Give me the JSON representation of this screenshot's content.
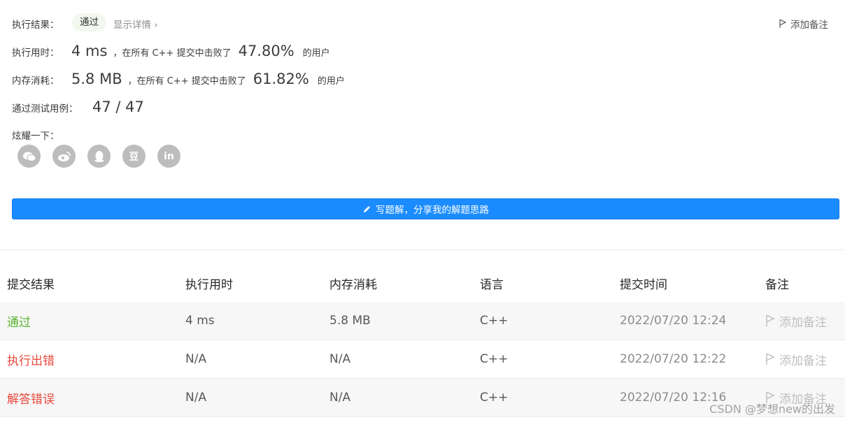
{
  "result": {
    "label": "执行结果：",
    "status": "通过",
    "details_link": "显示详情 ›",
    "add_note": "添加备注"
  },
  "time_stat": {
    "label": "执行用时：",
    "value": "4 ms",
    "mid_text": "，在所有 C++ 提交中击败了",
    "percent": "47.80%",
    "tail": "的用户"
  },
  "memory_stat": {
    "label": "内存消耗：",
    "value": "5.8 MB",
    "mid_text": "，在所有 C++ 提交中击败了",
    "percent": "61.82%",
    "tail": "的用户"
  },
  "test_cases": {
    "label": "通过测试用例：",
    "value": "47 / 47"
  },
  "share": {
    "label": "炫耀一下：",
    "icons": [
      "wechat-icon",
      "weibo-icon",
      "qq-icon",
      "douban-icon",
      "linkedin-icon"
    ],
    "douban_glyph": "豆",
    "linkedin_glyph": "in"
  },
  "solution_button": "写题解，分享我的解题思路",
  "table": {
    "headers": [
      "提交结果",
      "执行用时",
      "内存消耗",
      "语言",
      "提交时间",
      "备注"
    ],
    "rows": [
      {
        "status": "通过",
        "time": "4 ms",
        "memory": "5.8 MB",
        "language": "C++",
        "submitted": "2022/07/20 12:24",
        "note": "添加备注"
      },
      {
        "status": "执行出错",
        "time": "N/A",
        "memory": "N/A",
        "language": "C++",
        "submitted": "2022/07/20 12:22",
        "note": "添加备注"
      },
      {
        "status": "解答错误",
        "time": "N/A",
        "memory": "N/A",
        "language": "C++",
        "submitted": "2022/07/20 12:16",
        "note": "添加备注"
      }
    ]
  },
  "watermark": "CSDN @梦想new的出发",
  "colors": {
    "accent": "#1a8cff",
    "success": "#5bb12f",
    "error": "#e8483b"
  }
}
